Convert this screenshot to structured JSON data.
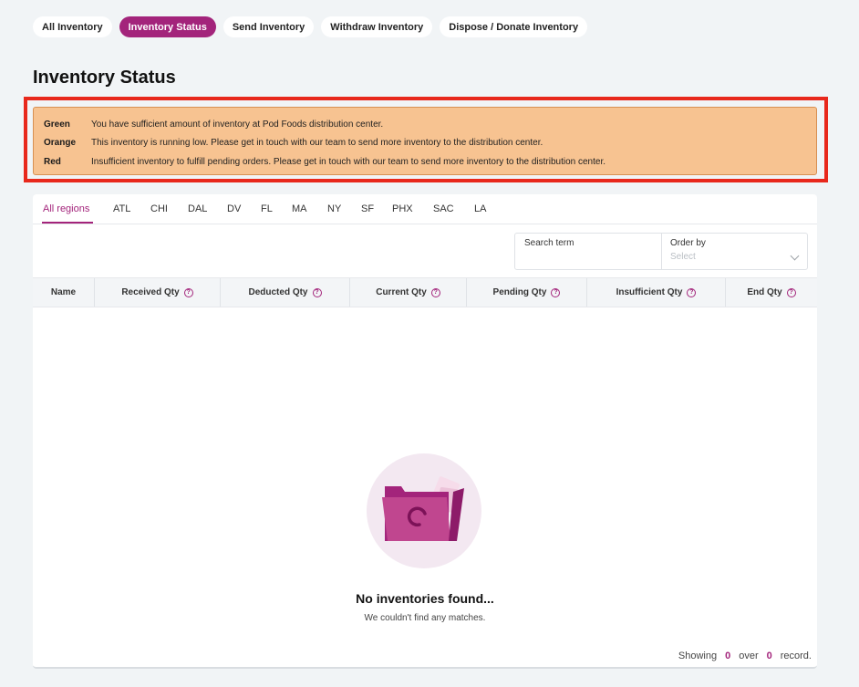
{
  "nav": {
    "tabs": [
      {
        "label": "All Inventory",
        "active": false
      },
      {
        "label": "Inventory Status",
        "active": true
      },
      {
        "label": "Send Inventory",
        "active": false
      },
      {
        "label": "Withdraw Inventory",
        "active": false
      },
      {
        "label": "Dispose / Donate Inventory",
        "active": false
      }
    ]
  },
  "page": {
    "title": "Inventory Status"
  },
  "legend": {
    "items": [
      {
        "key": "Green",
        "text": "You have sufficient amount of inventory at Pod Foods distribution center."
      },
      {
        "key": "Orange",
        "text": "This inventory is running low. Please get in touch with our team to send more inventory to the distribution center."
      },
      {
        "key": "Red",
        "text": "Insufficient inventory to fulfill pending orders. Please get in touch with our team to send more inventory to the distribution center."
      }
    ]
  },
  "regions": {
    "tabs": [
      "All regions",
      "ATL",
      "CHI",
      "DAL",
      "DV",
      "FL",
      "MA",
      "NY",
      "SF",
      "PHX",
      "SAC",
      "LA"
    ],
    "active": "All regions"
  },
  "filters": {
    "search_label": "Search term",
    "search_value": "",
    "order_label": "Order by",
    "order_placeholder": "Select"
  },
  "table": {
    "columns": [
      {
        "label": "Name",
        "help": false
      },
      {
        "label": "Received Qty",
        "help": true
      },
      {
        "label": "Deducted Qty",
        "help": true
      },
      {
        "label": "Current Qty",
        "help": true
      },
      {
        "label": "Pending Qty",
        "help": true
      },
      {
        "label": "Insufficient Qty",
        "help": true
      },
      {
        "label": "End Qty",
        "help": true
      }
    ],
    "rows": []
  },
  "empty_state": {
    "title": "No inventories found...",
    "subtitle": "We couldn't find any matches."
  },
  "footer": {
    "showing_label": "Showing",
    "shown_count": "0",
    "over_label": "over",
    "total_count": "0",
    "record_label": "record."
  },
  "colors": {
    "accent": "#a3247b",
    "legend_bg": "#f7c391",
    "highlight": "#e8281c",
    "background": "#f1f4f6"
  },
  "icons": {
    "help": "question-circle-icon",
    "empty": "folder-icon",
    "dropdown": "chevron-down-icon"
  }
}
